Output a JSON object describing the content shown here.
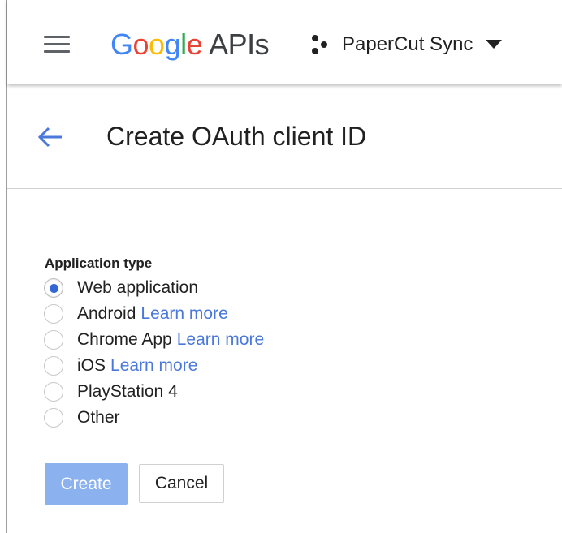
{
  "header": {
    "logo_letters": [
      "G",
      "o",
      "o",
      "g",
      "l",
      "e"
    ],
    "logo_suffix": "APIs",
    "project_name": "PaperCut Sync",
    "project_icon": "project-dots-icon",
    "menu_icon": "hamburger-menu-icon",
    "dropdown_icon": "caret-down-icon"
  },
  "page": {
    "title": "Create OAuth client ID",
    "back_icon": "arrow-back-icon"
  },
  "form": {
    "group_label": "Application type",
    "options": [
      {
        "label": "Web application",
        "link": "",
        "selected": true
      },
      {
        "label": "Android",
        "link": "Learn more",
        "selected": false
      },
      {
        "label": "Chrome App",
        "link": "Learn more",
        "selected": false
      },
      {
        "label": "iOS",
        "link": "Learn more",
        "selected": false
      },
      {
        "label": "PlayStation 4",
        "link": "",
        "selected": false
      },
      {
        "label": "Other",
        "link": "",
        "selected": false
      }
    ],
    "create_label": "Create",
    "cancel_label": "Cancel"
  },
  "colors": {
    "accent": "#3367d6",
    "link": "#4a78db",
    "create_button_disabled": "#8cb1ef",
    "google_blue": "#4285F4",
    "google_red": "#EA4335",
    "google_yellow": "#FBBC05",
    "google_green": "#34A853"
  }
}
